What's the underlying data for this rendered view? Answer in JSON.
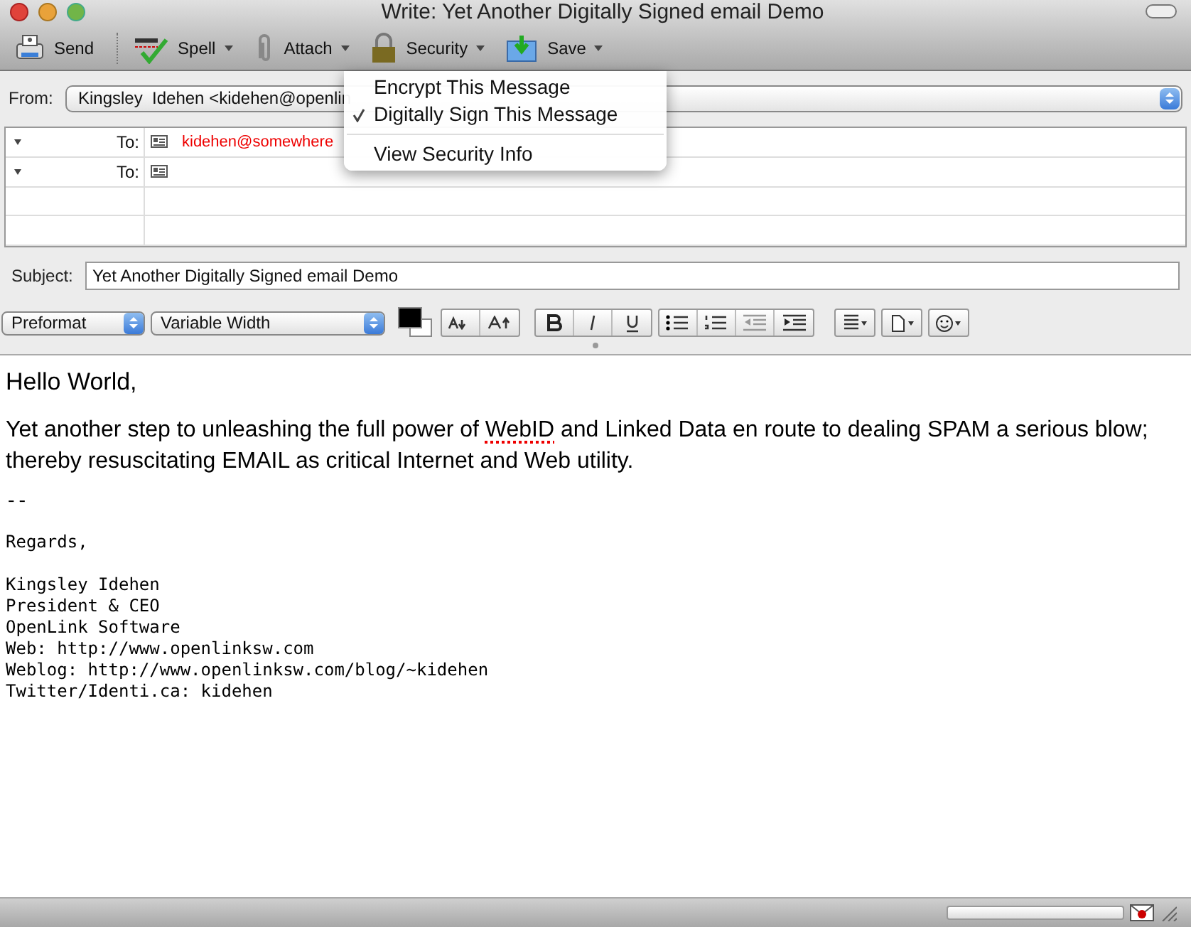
{
  "window": {
    "title": "Write: Yet Another Digitally Signed email Demo"
  },
  "toolbar": [
    {
      "kind": "send",
      "label": "Send",
      "menu": false
    },
    {
      "kind": "spell",
      "label": "Spell",
      "menu": true
    },
    {
      "kind": "attach",
      "label": "Attach",
      "menu": true
    },
    {
      "kind": "security",
      "label": "Security",
      "menu": true
    },
    {
      "kind": "save",
      "label": "Save",
      "menu": true
    }
  ],
  "security_menu": {
    "items": [
      {
        "label": "Encrypt This Message",
        "checked": false
      },
      {
        "label": "Digitally Sign This Message",
        "checked": true
      },
      {
        "label": "View Security Info",
        "checked": false,
        "separator_before": true
      }
    ]
  },
  "from": {
    "label": "From:",
    "value": "Kingsley  Idehen <kidehen@openlin"
  },
  "recipients": [
    {
      "type": "To:",
      "address": "kidehen@somewhere"
    },
    {
      "type": "To:"
    }
  ],
  "subject": {
    "label": "Subject:",
    "value": "Yet Another Digitally Signed email Demo"
  },
  "format_bar": {
    "paragraph_style": "Preformat",
    "font": "Variable Width"
  },
  "body": {
    "greeting": "Hello World,",
    "paragraph": [
      {
        "text": "Yet another step to unleashing the full power of ",
        "misspelled": false
      },
      {
        "text": "WebID",
        "misspelled": true
      },
      {
        "text": " and Linked Data en route to dealing SPAM a serious blow; thereby resuscitating EMAIL as critical Internet and Web utility.",
        "misspelled": false
      }
    ],
    "separator": "--",
    "closing": "Regards,",
    "signature": [
      "Kingsley Idehen",
      "President & CEO",
      "OpenLink Software",
      "Web: http://www.openlinksw.com",
      "Weblog: http://www.openlinksw.com/blog/~kidehen",
      "Twitter/Identi.ca: kidehen"
    ]
  },
  "status_bar": {
    "progress": {
      "level": 0
    }
  }
}
